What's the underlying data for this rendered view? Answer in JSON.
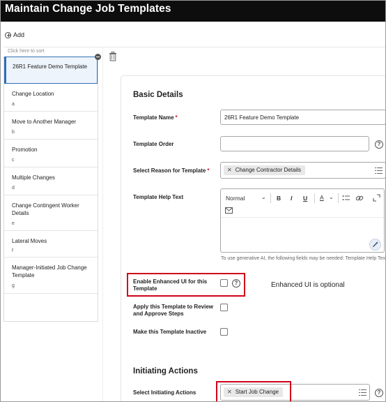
{
  "window": {
    "title": "Maintain Change Job Templates"
  },
  "toolbar": {
    "add_label": "Add"
  },
  "list": {
    "sort_hint": "Click here to sort",
    "items": [
      {
        "name": "26R1 Feature Demo Template",
        "sub": "",
        "selected": true
      },
      {
        "name": "Change Location",
        "sub": "a"
      },
      {
        "name": "Move to Another Manager",
        "sub": "b"
      },
      {
        "name": "Promotion",
        "sub": "c"
      },
      {
        "name": "Multiple Changes",
        "sub": "d"
      },
      {
        "name": "Change Contingent Worker Details",
        "sub": "e"
      },
      {
        "name": "Lateral Moves",
        "sub": "f"
      },
      {
        "name": "Manager-Initiated Job Change Template",
        "sub": "g"
      }
    ]
  },
  "basic_details": {
    "title": "Basic Details",
    "template_name_label": "Template Name",
    "template_name_value": "26R1 Feature Demo Template",
    "template_order_label": "Template Order",
    "template_order_value": "",
    "reason_label": "Select Reason for Template",
    "reason_pill": "Change Contractor Details",
    "help_text_label": "Template Help Text",
    "editor": {
      "style_select": "Normal",
      "bold": "B",
      "italic": "I",
      "underline": "U",
      "font_color": "A"
    },
    "ai_note": "To use generative AI, the following fields may be needed: Template Help Text",
    "enhanced_ui_label": "Enable Enhanced UI for this Template",
    "enhanced_ui_checked": false,
    "review_label": "Apply this Template to Review and Approve Steps",
    "review_checked": false,
    "inactive_label": "Make this Template Inactive",
    "inactive_checked": false,
    "required_marker": "*"
  },
  "annotation": {
    "text": "Enhanced UI is optional"
  },
  "initiating_actions": {
    "title": "Initiating Actions",
    "select_label": "Select Initiating Actions",
    "action_pill": "Start Job Change"
  },
  "colors": {
    "title_bar": "#0d0d0d",
    "highlight": "#d0021b",
    "required": "#c8102e",
    "selected_item": "#2f6fb8"
  },
  "icons": [
    "add-icon",
    "remove-icon",
    "trash-icon",
    "help-icon",
    "list-icon",
    "ai-assist-icon",
    "email-icon",
    "link-icon",
    "expand-icon",
    "bullet-list-icon",
    "chevron-down-icon",
    "close-icon"
  ]
}
